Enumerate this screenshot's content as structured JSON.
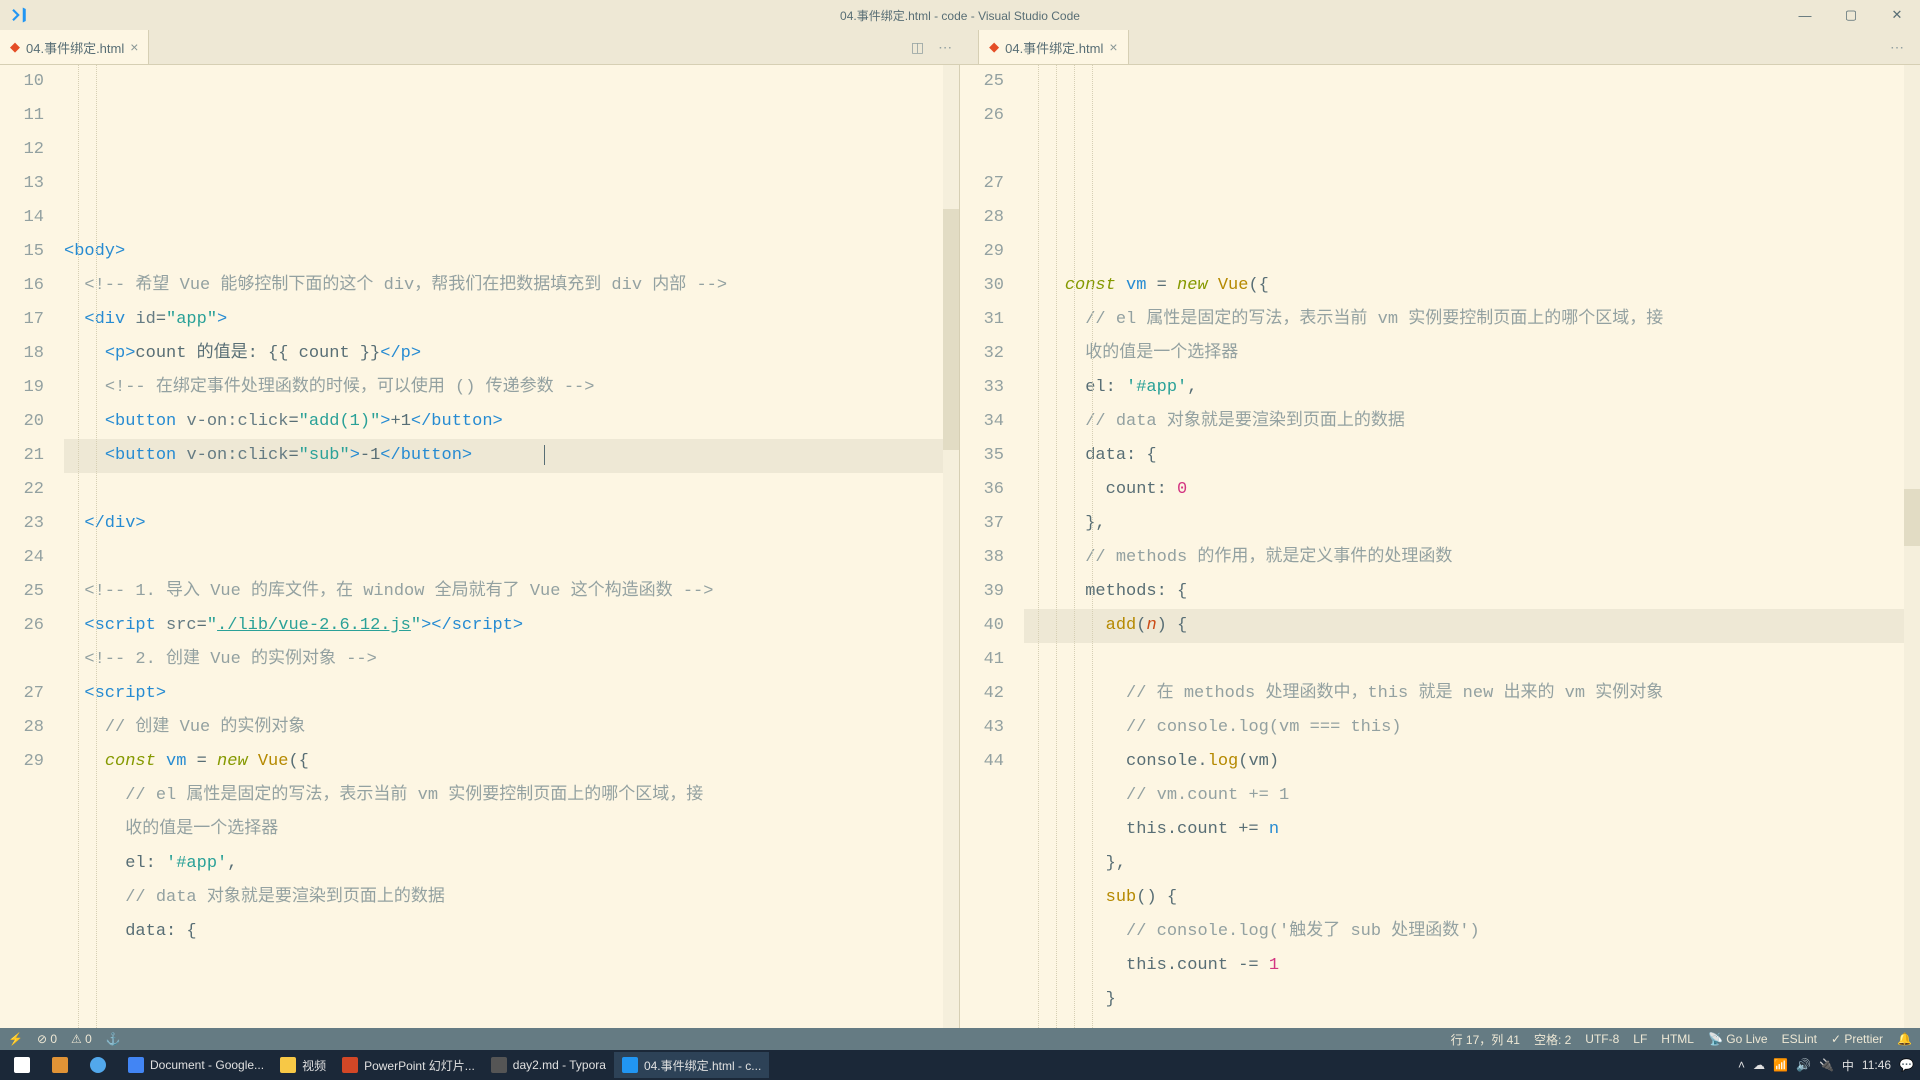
{
  "window": {
    "title": "04.事件绑定.html - code - Visual Studio Code"
  },
  "tabs": {
    "left": {
      "name": "04.事件绑定.html"
    },
    "right": {
      "name": "04.事件绑定.html"
    }
  },
  "left_pane": {
    "lines": [
      "10",
      "11",
      "12",
      "13",
      "14",
      "15",
      "16",
      "17",
      "18",
      "19",
      "20",
      "21",
      "22",
      "23",
      "24",
      "25",
      "26",
      "",
      "27",
      "28",
      "29"
    ],
    "code": [
      {
        "t": "blank"
      },
      {
        "t": "tag_open",
        "indent": 0,
        "name": "body"
      },
      {
        "t": "html_comm",
        "indent": 1,
        "text": "希望 Vue 能够控制下面的这个 div，帮我们在把数据填充到 div 内部"
      },
      {
        "t": "div_open",
        "indent": 1,
        "id": "app"
      },
      {
        "t": "p_count",
        "indent": 2,
        "text": "count 的值是: {{ count }}"
      },
      {
        "t": "html_comm",
        "indent": 2,
        "text": "在绑定事件处理函数的时候，可以使用 () 传递参数"
      },
      {
        "t": "button",
        "indent": 2,
        "event": "add(1)",
        "label": "+1"
      },
      {
        "t": "button",
        "indent": 2,
        "event": "sub",
        "label": "-1",
        "highlight": true,
        "cursor": true
      },
      {
        "t": "tag_close",
        "indent": 1,
        "name": "div"
      },
      {
        "t": "blank"
      },
      {
        "t": "html_comm",
        "indent": 1,
        "text": "1. 导入 Vue 的库文件，在 window 全局就有了 Vue 这个构造函数"
      },
      {
        "t": "script_src",
        "indent": 1,
        "src": "./lib/vue-2.6.12.js"
      },
      {
        "t": "html_comm",
        "indent": 1,
        "text": "2. 创建 Vue 的实例对象"
      },
      {
        "t": "tag_open",
        "indent": 1,
        "name": "script"
      },
      {
        "t": "js_comm",
        "indent": 2,
        "text": "创建 Vue 的实例对象"
      },
      {
        "t": "const_vue",
        "indent": 2
      },
      {
        "t": "js_comm",
        "indent": 3,
        "text": "el 属性是固定的写法，表示当前 vm 实例要控制页面上的哪个区域，接"
      },
      {
        "t": "js_comm_cont",
        "indent": 3,
        "text": "收的值是一个选择器"
      },
      {
        "t": "el",
        "indent": 3,
        "val": "#app"
      },
      {
        "t": "js_comm",
        "indent": 3,
        "text": "data 对象就是要渲染到页面上的数据"
      },
      {
        "t": "data_open",
        "indent": 3
      }
    ]
  },
  "right_pane": {
    "lines": [
      "25",
      "26",
      "",
      "27",
      "28",
      "29",
      "30",
      "31",
      "32",
      "33",
      "34",
      "35",
      "36",
      "37",
      "38",
      "39",
      "40",
      "41",
      "42",
      "43",
      "44"
    ],
    "code": [
      {
        "t": "const_vue",
        "indent": 2
      },
      {
        "t": "js_comm",
        "indent": 3,
        "text": "el 属性是固定的写法，表示当前 vm 实例要控制页面上的哪个区域，接"
      },
      {
        "t": "js_comm_cont",
        "indent": 3,
        "text": "收的值是一个选择器"
      },
      {
        "t": "el",
        "indent": 3,
        "val": "#app"
      },
      {
        "t": "js_comm",
        "indent": 3,
        "text": "data 对象就是要渲染到页面上的数据"
      },
      {
        "t": "obj_open",
        "indent": 3,
        "key": "data"
      },
      {
        "t": "kv_num",
        "indent": 4,
        "key": "count",
        "val": "0"
      },
      {
        "t": "obj_close_comma",
        "indent": 3
      },
      {
        "t": "js_comm",
        "indent": 3,
        "text": "methods 的作用，就是定义事件的处理函数"
      },
      {
        "t": "obj_open",
        "indent": 3,
        "key": "methods"
      },
      {
        "t": "fn_open",
        "indent": 4,
        "name": "add",
        "param": "n",
        "highlight": true
      },
      {
        "t": "js_comm",
        "indent": 5,
        "text": "在 methods 处理函数中，this 就是 new 出来的 vm 实例对象"
      },
      {
        "t": "js_comm",
        "indent": 5,
        "text": "console.log(vm === this)"
      },
      {
        "t": "console_log",
        "indent": 5,
        "arg": "vm"
      },
      {
        "t": "js_comm",
        "indent": 5,
        "text": "vm.count += 1"
      },
      {
        "t": "stmt",
        "indent": 5,
        "text": "this.count += n"
      },
      {
        "t": "obj_close_comma",
        "indent": 4
      },
      {
        "t": "fn_open",
        "indent": 4,
        "name": "sub",
        "param": ""
      },
      {
        "t": "js_comm",
        "indent": 5,
        "text": "console.log('触发了 sub 处理函数')"
      },
      {
        "t": "stmt",
        "indent": 5,
        "text": "this.count -= 1"
      },
      {
        "t": "brace_close",
        "indent": 4
      }
    ]
  },
  "status": {
    "errors": "0",
    "warnings": "0",
    "ln_col": "行 17，列 41",
    "spaces": "空格: 2",
    "encoding": "UTF-8",
    "eol": "LF",
    "lang": "HTML",
    "golive": "Go Live",
    "eslint": "ESLint",
    "prettier": "Prettier"
  },
  "taskbar": {
    "items": [
      {
        "label": "Document - Google...",
        "active": false
      },
      {
        "label": "视频",
        "active": false
      },
      {
        "label": "PowerPoint 幻灯片...",
        "active": false
      },
      {
        "label": "day2.md - Typora",
        "active": false
      },
      {
        "label": "04.事件绑定.html - c...",
        "active": true
      }
    ],
    "time": "11:46"
  }
}
